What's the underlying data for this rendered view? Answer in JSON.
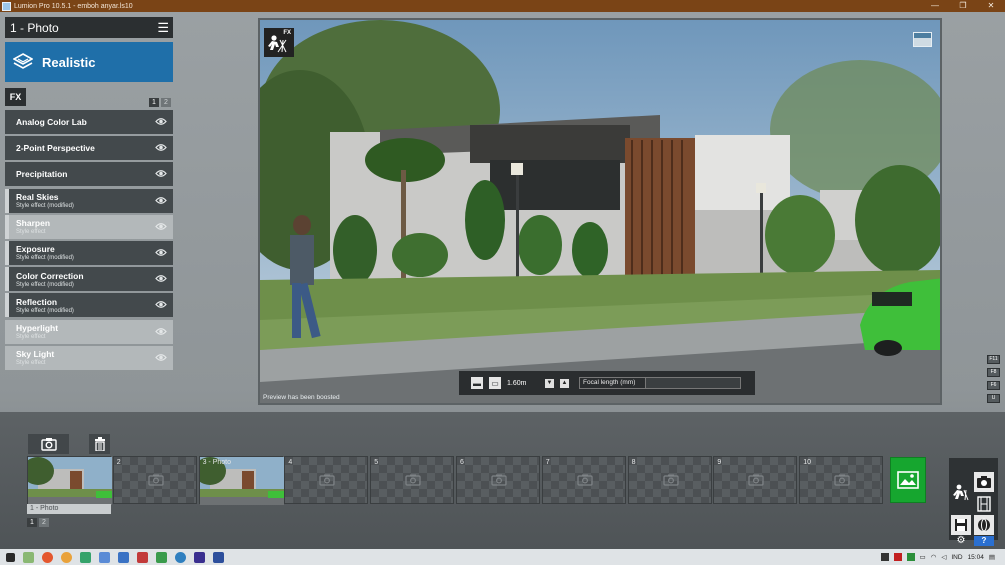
{
  "window": {
    "title": "Lumion Pro 10.5.1  - emboh anyar.ls10",
    "controls": [
      "—",
      "❐",
      "✕"
    ]
  },
  "left_panel": {
    "scene_title": "1 - Photo",
    "style_label": "Realistic",
    "fx_tag": "FX",
    "pages": [
      "1",
      "2"
    ],
    "effects": [
      {
        "name": "Analog Color Lab",
        "sub": "",
        "tone": "dark",
        "bar": false
      },
      {
        "name": "2-Point Perspective",
        "sub": "",
        "tone": "dark",
        "bar": false
      },
      {
        "name": "Precipitation",
        "sub": "",
        "tone": "dark",
        "bar": false
      },
      {
        "name": "Real Skies",
        "sub": "Style effect (modified)",
        "tone": "dark",
        "bar": true
      },
      {
        "name": "Sharpen",
        "sub": "Style effect",
        "tone": "light",
        "bar": true
      },
      {
        "name": "Exposure",
        "sub": "Style effect (modified)",
        "tone": "dark",
        "bar": true
      },
      {
        "name": "Color Correction",
        "sub": "Style effect (modified)",
        "tone": "dark",
        "bar": true
      },
      {
        "name": "Reflection",
        "sub": "Style effect (modified)",
        "tone": "dark",
        "bar": true
      },
      {
        "name": "Hyperlight",
        "sub": "Style effect",
        "tone": "light",
        "bar": false
      },
      {
        "name": "Sky Light",
        "sub": "Style effect",
        "tone": "light",
        "bar": false
      }
    ]
  },
  "viewport": {
    "fx_badge": "FX",
    "preview_note": "Preview has been boosted",
    "camera_height": "1.60m",
    "focal_label": "Focal length (mm)"
  },
  "side_keys": [
    "F11",
    "F8",
    "F6",
    "U"
  ],
  "strip": {
    "slots": [
      "1",
      "2",
      "3",
      "4",
      "5",
      "6",
      "7",
      "8",
      "9",
      "10"
    ],
    "slot3_label": "3 - Photo",
    "caption": "1 - Photo",
    "pages": [
      "1",
      "2"
    ]
  },
  "taskbar": {
    "lang": "IND",
    "time": "15:04"
  },
  "colors": {
    "accent": "#1f6fa9",
    "render": "#16a62f",
    "titlebar": "#7a4416"
  }
}
